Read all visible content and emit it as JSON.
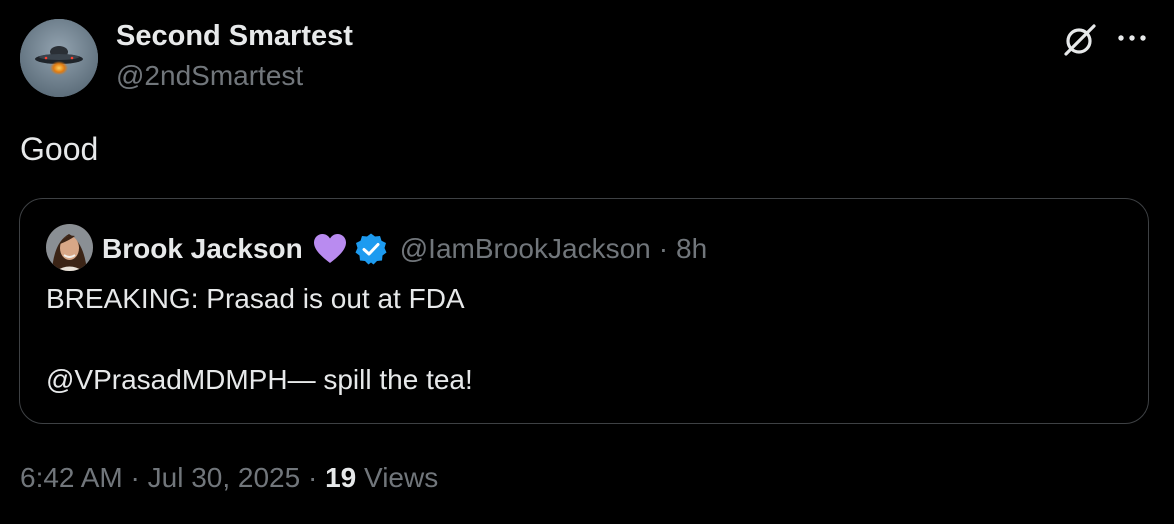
{
  "tweet": {
    "author": {
      "display_name": "Second Smartest",
      "handle": "@2ndSmartest",
      "avatar": "ufo-avatar"
    },
    "text": "Good",
    "quoted": {
      "author": {
        "display_name": "Brook Jackson",
        "emoji": "purple-heart",
        "verified": true,
        "handle": "@IamBrookJackson",
        "separator": "·",
        "time_ago": "8h"
      },
      "lines": [
        "BREAKING: Prasad is out at FDA",
        "@VPrasadMDMPH— spill the tea!"
      ]
    },
    "meta": {
      "time": "6:42 AM",
      "separator": "·",
      "date": "Jul 30, 2025",
      "views_count": "19",
      "views_label": "Views"
    }
  },
  "icons": {
    "grok": "grok-icon",
    "more": "more-icon",
    "verified": "verified-badge-icon",
    "heart": "purple-heart-icon"
  },
  "colors": {
    "background": "#000000",
    "text": "#e7e9ea",
    "muted": "#71767b",
    "border": "#3e4144",
    "verified": "#1d9bf0",
    "heart": "#b98bf0"
  }
}
